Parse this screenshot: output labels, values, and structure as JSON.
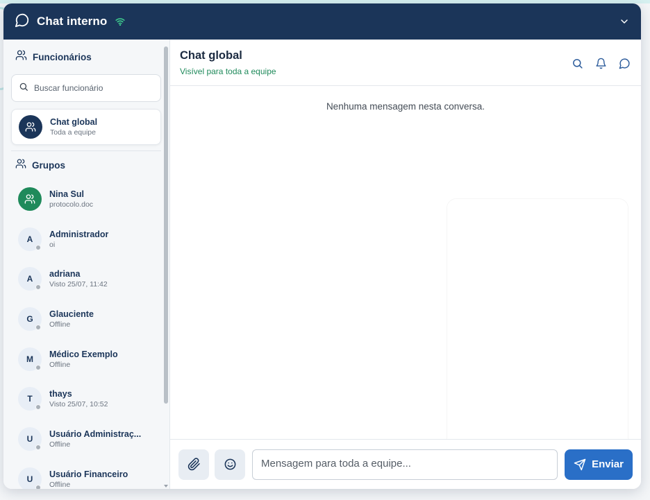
{
  "header": {
    "title": "Chat interno"
  },
  "sidebar": {
    "employees_label": "Funcionários",
    "search_placeholder": "Buscar funcionário",
    "global_chat": {
      "name": "Chat global",
      "sub": "Toda a equipe"
    },
    "groups_label": "Grupos",
    "contacts": [
      {
        "initial": "",
        "name": "Nina Sul",
        "sub": "protocolo.doc",
        "type": "group"
      },
      {
        "initial": "A",
        "name": "Administrador",
        "sub": "oi",
        "type": "user"
      },
      {
        "initial": "A",
        "name": "adriana",
        "sub": "Visto 25/07, 11:42",
        "type": "user"
      },
      {
        "initial": "G",
        "name": "Glauciente",
        "sub": "Offline",
        "type": "user"
      },
      {
        "initial": "M",
        "name": "Médico Exemplo",
        "sub": "Offline",
        "type": "user"
      },
      {
        "initial": "T",
        "name": "thays",
        "sub": "Visto 25/07, 10:52",
        "type": "user"
      },
      {
        "initial": "U",
        "name": "Usuário Administraç...",
        "sub": "Offline",
        "type": "user"
      },
      {
        "initial": "U",
        "name": "Usuário Financeiro",
        "sub": "Offline",
        "type": "user"
      }
    ]
  },
  "chat": {
    "title": "Chat global",
    "subtitle": "Visível para toda a equipe",
    "empty_message": "Nenhuma mensagem nesta conversa.",
    "input_placeholder": "Mensagem para toda a equipe...",
    "send_label": "Enviar"
  },
  "colors": {
    "navy": "#1b3559",
    "accent_green": "#1f8a5b",
    "send_blue": "#2a6fc7",
    "offline_dot": "#a9b0b8"
  }
}
